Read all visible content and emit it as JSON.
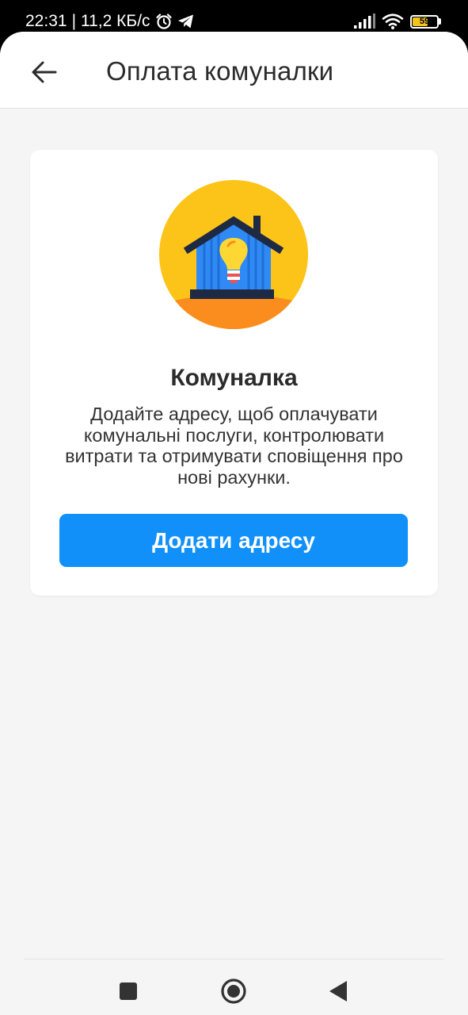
{
  "status_bar": {
    "time": "22:31",
    "separator": "|",
    "network_speed": "11,2 КБ/с",
    "battery_level": "59",
    "icons": [
      "alarm-icon",
      "telegram-icon",
      "signal-icon",
      "wifi-icon",
      "battery-icon"
    ]
  },
  "header": {
    "back_icon": "arrow-left-icon",
    "title": "Оплата комуналки"
  },
  "card": {
    "illustration": "house-lightbulb-illustration",
    "title": "Комуналка",
    "description": "Додайте адресу, щоб оплачувати комунальні послуги, контролювати витрати та отримувати сповіщення про нові рахунки.",
    "button_label": "Додати адресу"
  },
  "nav_bar": {
    "icons": [
      "recents-square-icon",
      "home-circle-icon",
      "back-triangle-icon"
    ]
  },
  "colors": {
    "primary_button": "#1090f8",
    "background": "#f5f5f5",
    "illustration_circle": "#fcc419",
    "illustration_ground": "#fb8c1e",
    "battery_fill": "#f2c41c"
  }
}
